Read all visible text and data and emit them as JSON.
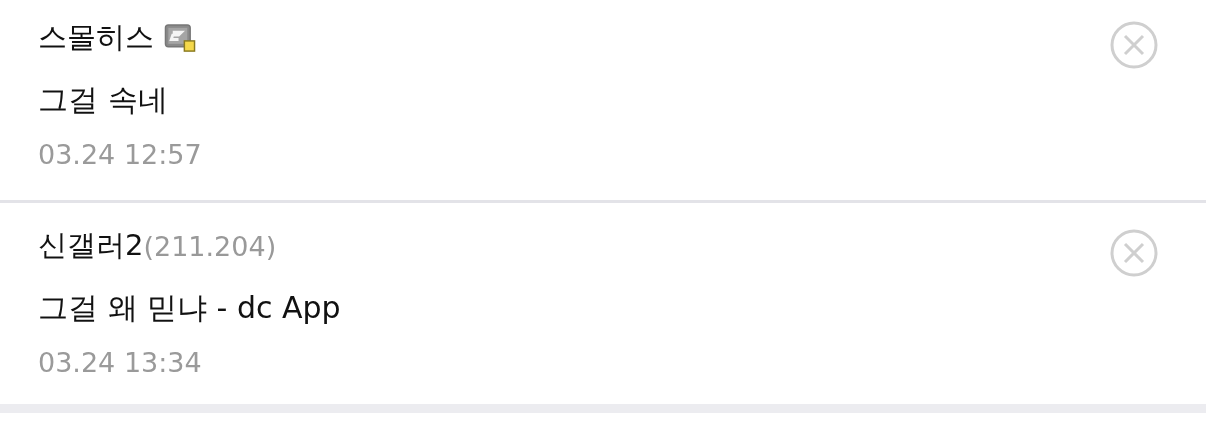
{
  "comments": [
    {
      "author": "스몰히스",
      "member_icon": true,
      "text": "그걸 속네",
      "date": "03.24 12:57"
    },
    {
      "author": "신갤러2",
      "ip": "(211.204)",
      "member_icon": false,
      "text": "그걸 왜 믿냐 - dc App",
      "date": "03.24 13:34"
    }
  ]
}
